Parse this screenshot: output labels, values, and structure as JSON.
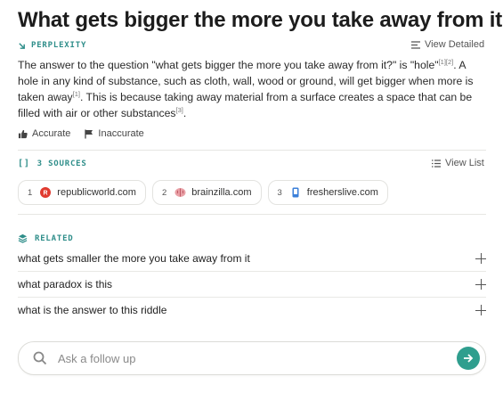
{
  "question": "What gets bigger the more you take away from it?",
  "answer_section": {
    "label": "PERPLEXITY",
    "view_detailed": "View Detailed",
    "text_parts": {
      "p1": "The answer to the question \"what gets bigger the more you take away from it?\" is \"hole\"",
      "cite1": "[1][2]",
      "p2": ". A hole in any kind of substance, such as cloth, wall, wood or ground, will get bigger when more is taken away",
      "cite2": "[1]",
      "p3": ". This is because taking away material from a surface creates a space that can be filled with air or other substances",
      "cite3": "[3]",
      "p4": "."
    },
    "feedback": {
      "accurate": "Accurate",
      "inaccurate": "Inaccurate"
    }
  },
  "sources": {
    "label": "3 SOURCES",
    "view_list": "View List",
    "items": [
      {
        "num": "1",
        "domain": "republicworld.com",
        "icon": "republicworld-favicon"
      },
      {
        "num": "2",
        "domain": "brainzilla.com",
        "icon": "brainzilla-favicon"
      },
      {
        "num": "3",
        "domain": "fresherslive.com",
        "icon": "fresherslive-favicon"
      }
    ]
  },
  "related": {
    "label": "RELATED",
    "items": [
      "what gets smaller the more you take away from it",
      "what paradox is this",
      "what is the answer to this riddle"
    ]
  },
  "followup": {
    "placeholder": "Ask a follow up"
  },
  "colors": {
    "accent": "#2f8e8a",
    "send_button": "#2f9e8e",
    "republic_red": "#e03a2f"
  }
}
